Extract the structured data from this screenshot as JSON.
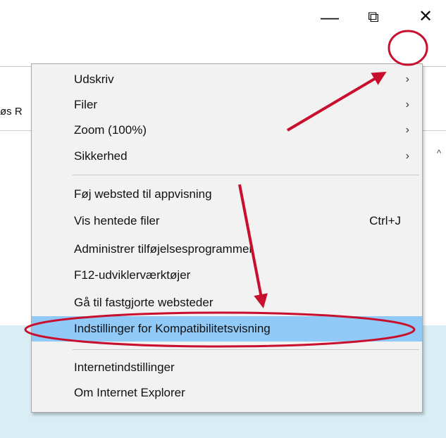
{
  "window": {
    "minimize_glyph": "—",
    "restore_glyph": "⧉",
    "close_glyph": "✕"
  },
  "toolbar": {
    "icons": [
      "home-icon",
      "favorites-star-icon",
      "tools-gear-icon",
      "smiley-feedback-icon"
    ]
  },
  "tab": {
    "partial_text": "øs R"
  },
  "menu": {
    "items": [
      {
        "label": "Udskriv",
        "submenu": true
      },
      {
        "label": "Filer",
        "submenu": true
      },
      {
        "label": "Zoom (100%)",
        "submenu": true
      },
      {
        "label": "Sikkerhed",
        "submenu": true
      },
      {
        "label": "Føj websted til appvisning"
      },
      {
        "label": "Vis hentede filer",
        "shortcut": "Ctrl+J"
      },
      {
        "label": "Administrer tilføjelsesprogrammer"
      },
      {
        "label": "F12-udviklerværktøjer"
      },
      {
        "label": "Gå til fastgjorte websteder"
      },
      {
        "label": "Indstillinger for Kompatibilitetsvisning",
        "highlighted": true
      },
      {
        "label": "Internetindstillinger"
      },
      {
        "label": "Om Internet Explorer"
      }
    ],
    "chevron_glyph": "›"
  },
  "colors": {
    "highlight": "#91c9f7",
    "annotation_red": "#c8102e",
    "gear_blue": "#1e73be",
    "smiley_yellow": "#f4c20d"
  }
}
